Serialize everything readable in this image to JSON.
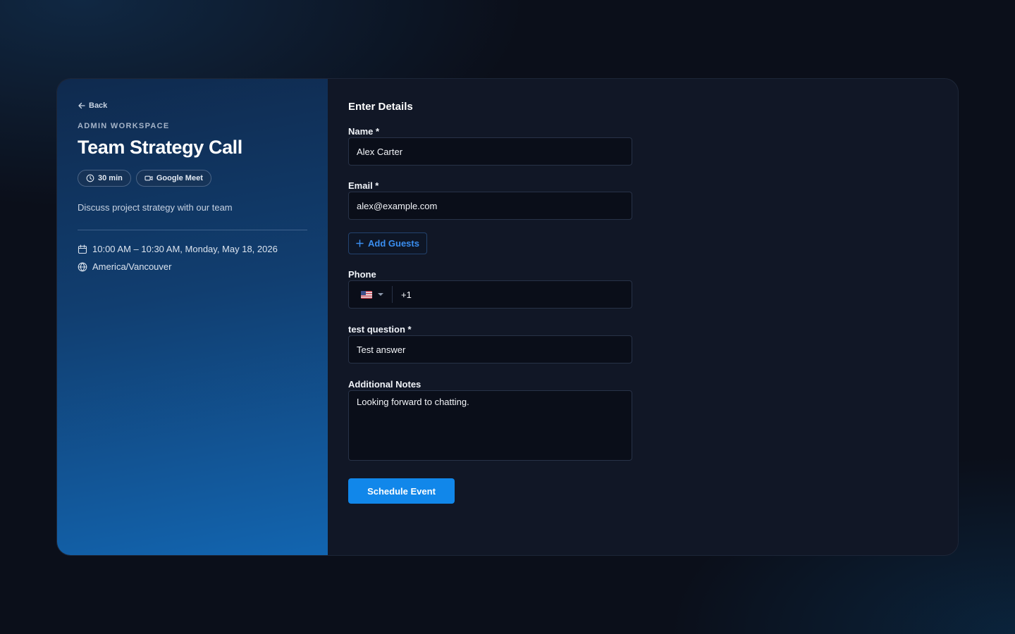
{
  "sidebar": {
    "back_label": "Back",
    "workspace": "ADMIN WORKSPACE",
    "title": "Team Strategy Call",
    "duration": "30 min",
    "location": "Google Meet",
    "description": "Discuss project strategy with our team",
    "datetime": "10:00 AM – 10:30 AM, Monday, May 18, 2026",
    "timezone": "America/Vancouver"
  },
  "form": {
    "title": "Enter Details",
    "name_label": "Name *",
    "name_value": "Alex Carter",
    "email_label": "Email *",
    "email_value": "alex@example.com",
    "add_guests_label": "Add Guests",
    "phone_label": "Phone",
    "phone_country": "US",
    "phone_code": "+1",
    "question_label": "test question *",
    "question_value": "Test answer",
    "notes_label": "Additional Notes",
    "notes_value": "Looking forward to chatting.",
    "submit_label": "Schedule Event"
  },
  "colors": {
    "accent": "#1187ea",
    "link": "#3a8ef0",
    "background": "#0b0f1a",
    "panel": "#111726"
  }
}
